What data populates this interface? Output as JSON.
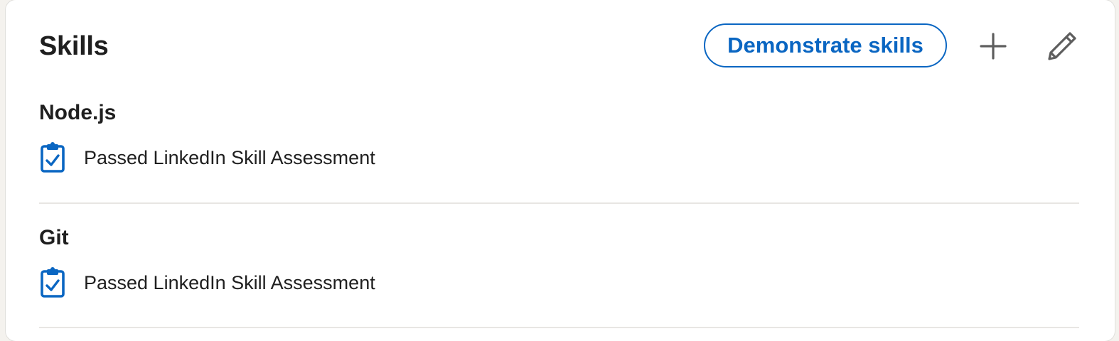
{
  "section": {
    "title": "Skills",
    "demonstrate_label": "Demonstrate skills",
    "add_icon": "plus-icon",
    "edit_icon": "pencil-icon"
  },
  "colors": {
    "accent": "#0a66c2",
    "text": "#1f1f1f",
    "icon_gray": "#5e5e5e",
    "divider": "#e8e6e3"
  },
  "skills": [
    {
      "name": "Node.js",
      "endorsement": "Passed LinkedIn Skill Assessment",
      "icon": "clipboard-check-icon"
    },
    {
      "name": "Git",
      "endorsement": "Passed LinkedIn Skill Assessment",
      "icon": "clipboard-check-icon"
    }
  ]
}
